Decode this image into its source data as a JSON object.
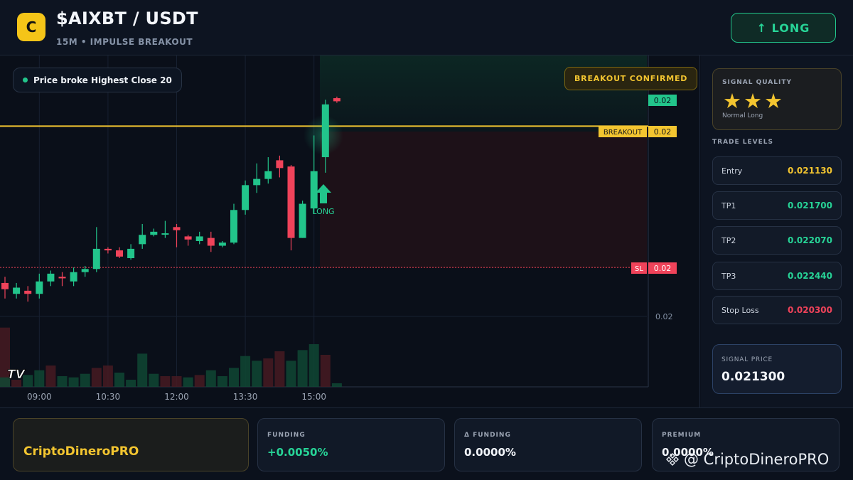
{
  "header": {
    "logo_letter": "C",
    "pair": "$AIXBT / USDT",
    "subtitle": "15M • IMPULSE BREAKOUT",
    "long_button": "↑ LONG"
  },
  "chart_overlay": {
    "status_pill": "Price broke Highest Close 20",
    "confirmed_badge": "BREAKOUT CONFIRMED",
    "long_marker_label": "LONG",
    "tradingview_logo": "TV",
    "price_tags": {
      "top": "0.02",
      "breakout_label": "BREAKOUT",
      "breakout_value": "0.02",
      "sl_label": "SL",
      "sl_value": "0.02",
      "axis_label": "0.02"
    }
  },
  "chart_data": {
    "type": "candlestick",
    "x_tick_labels": [
      "09:00",
      "10:30",
      "12:00",
      "13:30",
      "15:00"
    ],
    "x_tick_indices": [
      3,
      9,
      15,
      21,
      27
    ],
    "y_range": [
      0.01998,
      0.02161
    ],
    "levels": {
      "breakout": 0.02121,
      "stop_loss": 0.0203
    },
    "candles": [
      {
        "o": 0.0202,
        "h": 0.02024,
        "l": 0.0201,
        "c": 0.02016
      },
      {
        "o": 0.02013,
        "h": 0.0202,
        "l": 0.0201,
        "c": 0.02017
      },
      {
        "o": 0.02015,
        "h": 0.02018,
        "l": 0.02008,
        "c": 0.02013
      },
      {
        "o": 0.02013,
        "h": 0.02026,
        "l": 0.0201,
        "c": 0.02021
      },
      {
        "o": 0.02021,
        "h": 0.02028,
        "l": 0.02018,
        "c": 0.02026
      },
      {
        "o": 0.02024,
        "h": 0.02027,
        "l": 0.02018,
        "c": 0.02023
      },
      {
        "o": 0.02021,
        "h": 0.0203,
        "l": 0.02018,
        "c": 0.02027
      },
      {
        "o": 0.02027,
        "h": 0.02031,
        "l": 0.02024,
        "c": 0.02029
      },
      {
        "o": 0.02029,
        "h": 0.02056,
        "l": 0.02027,
        "c": 0.02042
      },
      {
        "o": 0.02042,
        "h": 0.02043,
        "l": 0.02039,
        "c": 0.02041
      },
      {
        "o": 0.02041,
        "h": 0.02043,
        "l": 0.02036,
        "c": 0.02037
      },
      {
        "o": 0.02036,
        "h": 0.02045,
        "l": 0.02035,
        "c": 0.02042
      },
      {
        "o": 0.02045,
        "h": 0.02058,
        "l": 0.02042,
        "c": 0.02051
      },
      {
        "o": 0.02051,
        "h": 0.02055,
        "l": 0.0205,
        "c": 0.02053
      },
      {
        "o": 0.02052,
        "h": 0.0206,
        "l": 0.02049,
        "c": 0.02052
      },
      {
        "o": 0.02056,
        "h": 0.02058,
        "l": 0.02043,
        "c": 0.02054
      },
      {
        "o": 0.0205,
        "h": 0.02051,
        "l": 0.02044,
        "c": 0.02048
      },
      {
        "o": 0.02047,
        "h": 0.02053,
        "l": 0.02045,
        "c": 0.0205
      },
      {
        "o": 0.02049,
        "h": 0.02053,
        "l": 0.0204,
        "c": 0.02044
      },
      {
        "o": 0.02044,
        "h": 0.02047,
        "l": 0.02043,
        "c": 0.02046
      },
      {
        "o": 0.02046,
        "h": 0.02071,
        "l": 0.02045,
        "c": 0.02067
      },
      {
        "o": 0.02067,
        "h": 0.02086,
        "l": 0.02064,
        "c": 0.02083
      },
      {
        "o": 0.02083,
        "h": 0.02097,
        "l": 0.02078,
        "c": 0.02087
      },
      {
        "o": 0.02087,
        "h": 0.02101,
        "l": 0.02084,
        "c": 0.02092
      },
      {
        "o": 0.02099,
        "h": 0.02102,
        "l": 0.02088,
        "c": 0.02094
      },
      {
        "o": 0.02095,
        "h": 0.02096,
        "l": 0.02041,
        "c": 0.02049
      },
      {
        "o": 0.02049,
        "h": 0.02073,
        "l": 0.02049,
        "c": 0.02071
      },
      {
        "o": 0.02068,
        "h": 0.02115,
        "l": 0.02065,
        "c": 0.02092
      },
      {
        "o": 0.02101,
        "h": 0.02138,
        "l": 0.02091,
        "c": 0.02135
      },
      {
        "o": 0.02139,
        "h": 0.0214,
        "l": 0.02136,
        "c": 0.02137
      }
    ],
    "volume": [
      50,
      8,
      6,
      10,
      14,
      18,
      9,
      8,
      11,
      16,
      18,
      12,
      6,
      28,
      11,
      9,
      9,
      8,
      10,
      14,
      9,
      16,
      26,
      22,
      24,
      30,
      22,
      31,
      36,
      27,
      3
    ]
  },
  "panel": {
    "quality_title": "SIGNAL QUALITY",
    "stars": "★★★",
    "quality_sub": "Normal Long",
    "levels_title": "TRADE LEVELS",
    "levels": [
      {
        "label": "Entry",
        "value": "0.021130",
        "color": "#f3c530"
      },
      {
        "label": "TP1",
        "value": "0.021700",
        "color": "#27d497"
      },
      {
        "label": "TP2",
        "value": "0.022070",
        "color": "#27d497"
      },
      {
        "label": "TP3",
        "value": "0.022440",
        "color": "#27d497"
      },
      {
        "label": "Stop Loss",
        "value": "0.020300",
        "color": "#f0435a"
      }
    ],
    "signal_title": "SIGNAL PRICE",
    "signal_value": "0.021300"
  },
  "footer": {
    "brand": "CriptoDineroPRO",
    "stats": [
      {
        "title": "FUNDING",
        "value": "+0.0050%",
        "color": "#27d497"
      },
      {
        "title": "Δ FUNDING",
        "value": "0.0000%",
        "color": "#f3f6fb"
      },
      {
        "title": "PREMIUM",
        "value": "0.0000%",
        "color": "#f3f6fb"
      }
    ],
    "watermark": "@ CriptoDineroPRO"
  },
  "colors": {
    "up": "#22c58b",
    "down": "#f0435a",
    "breakout": "#f3c530",
    "accent": "#27d497"
  }
}
